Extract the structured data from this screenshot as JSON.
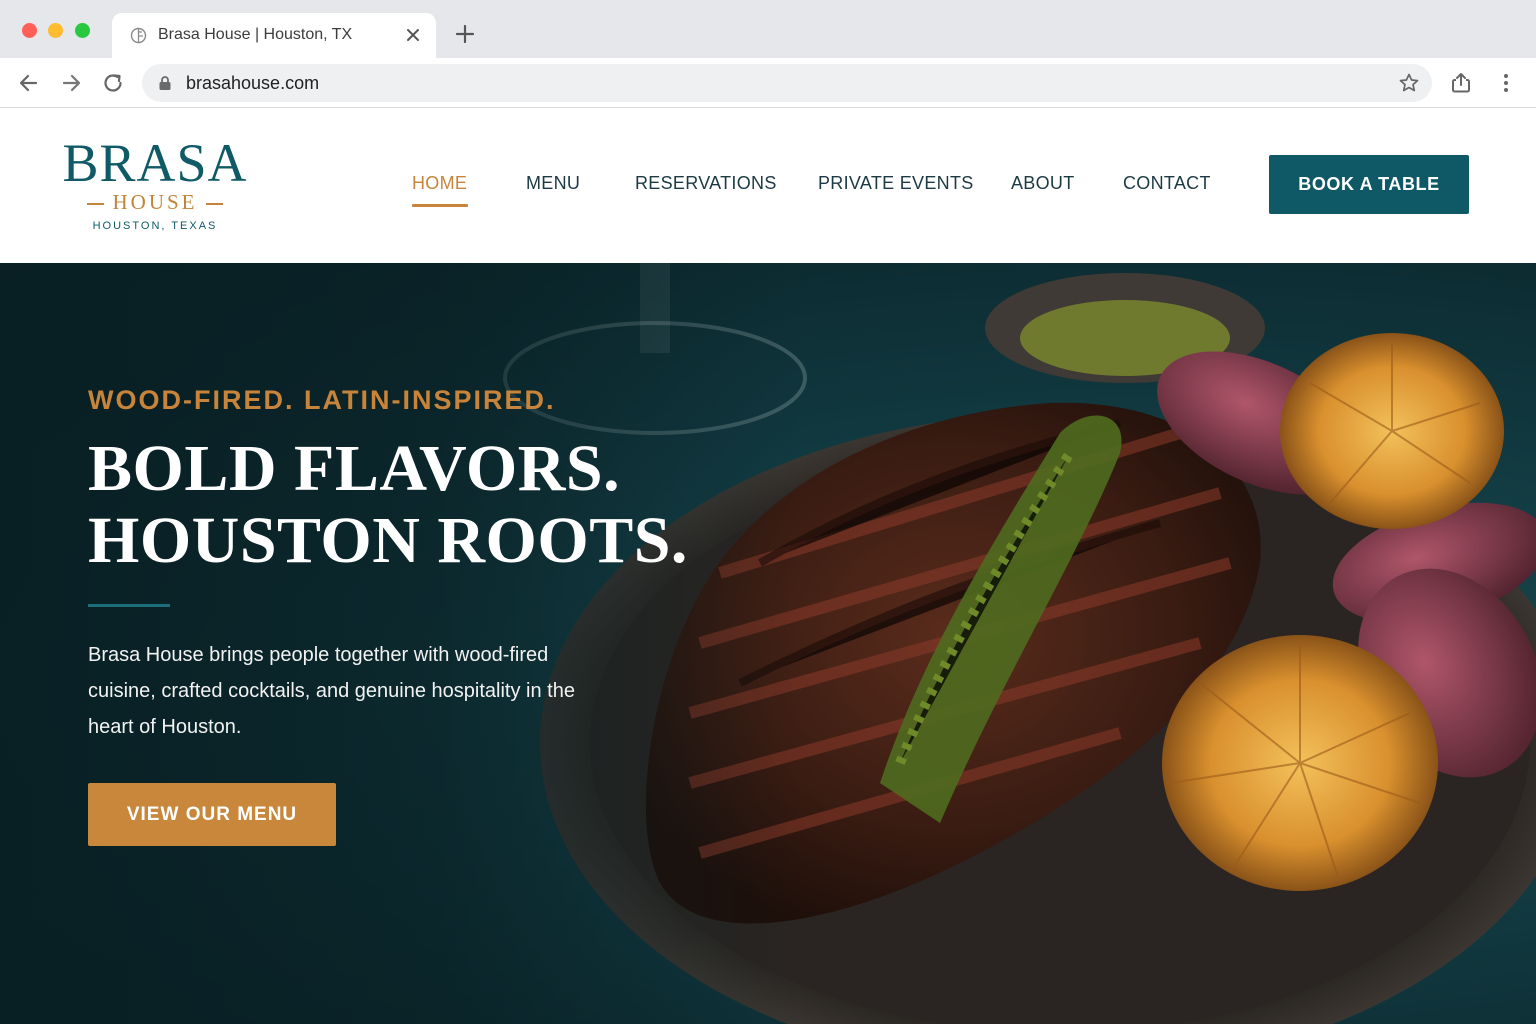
{
  "browser": {
    "tab_title": "Brasa House | Houston, TX",
    "url": "brasahouse.com"
  },
  "logo": {
    "main": "BRASA",
    "sub": "HOUSE",
    "city": "HOUSTON, TEXAS"
  },
  "nav": {
    "items": [
      {
        "label": "HOME",
        "active": true
      },
      {
        "label": "MENU"
      },
      {
        "label": "RESERVATIONS"
      },
      {
        "label": "PRIVATE EVENTS"
      },
      {
        "label": "ABOUT"
      },
      {
        "label": "CONTACT"
      }
    ],
    "cta": "BOOK A TABLE"
  },
  "hero": {
    "eyebrow": "WOOD-FIRED. LATIN-INSPIRED.",
    "headline_line1": "BOLD FLAVORS.",
    "headline_line2": "HOUSTON ROOTS.",
    "intro": "Brasa House brings people together with wood-fired cuisine, crafted cocktails, and genuine hospitality in the heart of Houston.",
    "cta": "VIEW OUR MENU"
  },
  "colors": {
    "brand_teal": "#0f5966",
    "brand_gold": "#c8843a",
    "hero_bg": "#123b42"
  },
  "icons": [
    "back-arrow-icon",
    "forward-arrow-icon",
    "reload-icon",
    "lock-icon",
    "star-icon",
    "share-icon",
    "more-vert-icon",
    "close-icon",
    "plus-icon"
  ]
}
